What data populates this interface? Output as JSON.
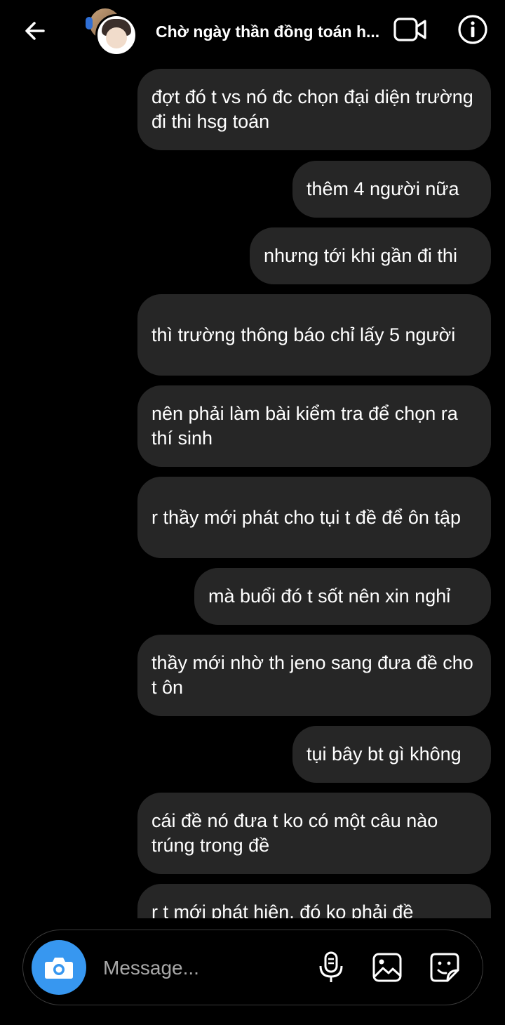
{
  "header": {
    "title": "Chờ ngày thần đồng toán h..."
  },
  "messages": [
    {
      "text": "đợt đó t vs nó đc chọn đại diện trường đi thi hsg toán"
    },
    {
      "text": "thêm 4 người nữa"
    },
    {
      "text": "nhưng tới khi gần đi thi"
    },
    {
      "text": "thì trường thông báo chỉ lấy 5 người"
    },
    {
      "text": "nên phải làm bài kiểm tra để chọn ra thí sinh"
    },
    {
      "text": "r thầy mới phát cho tụi t đề để ôn tập"
    },
    {
      "text": "mà buổi đó t sốt nên xin nghỉ"
    },
    {
      "text": "thầy mới nhờ th jeno sang đưa đề cho t ôn"
    },
    {
      "text": "tụi bây bt gì không"
    },
    {
      "text": "cái đề nó đưa t ko có một câu nào trúng trong đề"
    },
    {
      "text": "r t mới phát hiện, đó ko phải đề"
    }
  ],
  "composer": {
    "placeholder": "Message..."
  },
  "icons": {
    "back": "arrow-left-icon",
    "video": "video-camera-icon",
    "info": "info-icon",
    "camera": "camera-icon",
    "mic": "microphone-icon",
    "gallery": "image-icon",
    "sticker": "sticker-icon"
  },
  "colors": {
    "background": "#000000",
    "bubble": "#262626",
    "accent": "#3797f0",
    "placeholder": "#a8a8a8"
  }
}
